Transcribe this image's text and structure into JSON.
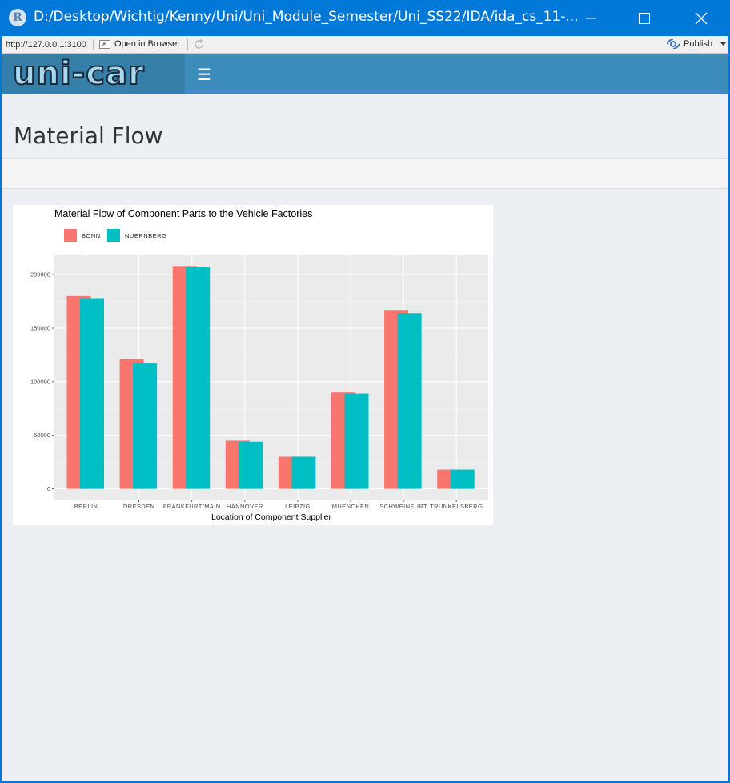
{
  "window": {
    "title": "D:/Desktop/Wichtig/Kenny/Uni/Uni_Module_Semester/Uni_SS22/IDA/ida_cs_11-..."
  },
  "viewer": {
    "url": "http://127.0.0.1:3100",
    "open_in_browser": "Open in Browser",
    "publish": "Publish"
  },
  "app": {
    "logo": "uni-car",
    "menu_icon": "hamburger-icon",
    "page_title": "Material Flow"
  },
  "colors": {
    "navbar": "#3c8dbc",
    "logo_bg": "#367fa9",
    "bonn": "#f8766d",
    "nuernberg": "#00bfc4",
    "panel_bg": "#ebebeb"
  },
  "chart_data": {
    "type": "bar",
    "title": "Material Flow of Component Parts to the Vehicle Factories",
    "xlabel": "Location of Component Supplier",
    "ylabel": "",
    "categories": [
      "BERLIN",
      "DRESDEN",
      "FRANKFURT/MAIN",
      "HANNOVER",
      "LEIPZIG",
      "MUENCHEN",
      "SCHWEINFURT",
      "TRUNKELSBERG"
    ],
    "series": [
      {
        "name": "BONN",
        "values": [
          180000,
          121000,
          208000,
          45000,
          30000,
          90000,
          167000,
          18000
        ]
      },
      {
        "name": "NUERNBERG",
        "values": [
          178000,
          117000,
          207000,
          44000,
          30000,
          89000,
          164000,
          18000
        ]
      }
    ],
    "yticks": [
      0,
      50000,
      100000,
      150000,
      200000
    ],
    "ytick_labels": [
      "0",
      "50000",
      "100000",
      "150000",
      "200000"
    ],
    "ylim": [
      -10000,
      218000
    ],
    "legend_position": "top-left",
    "grid": true
  }
}
